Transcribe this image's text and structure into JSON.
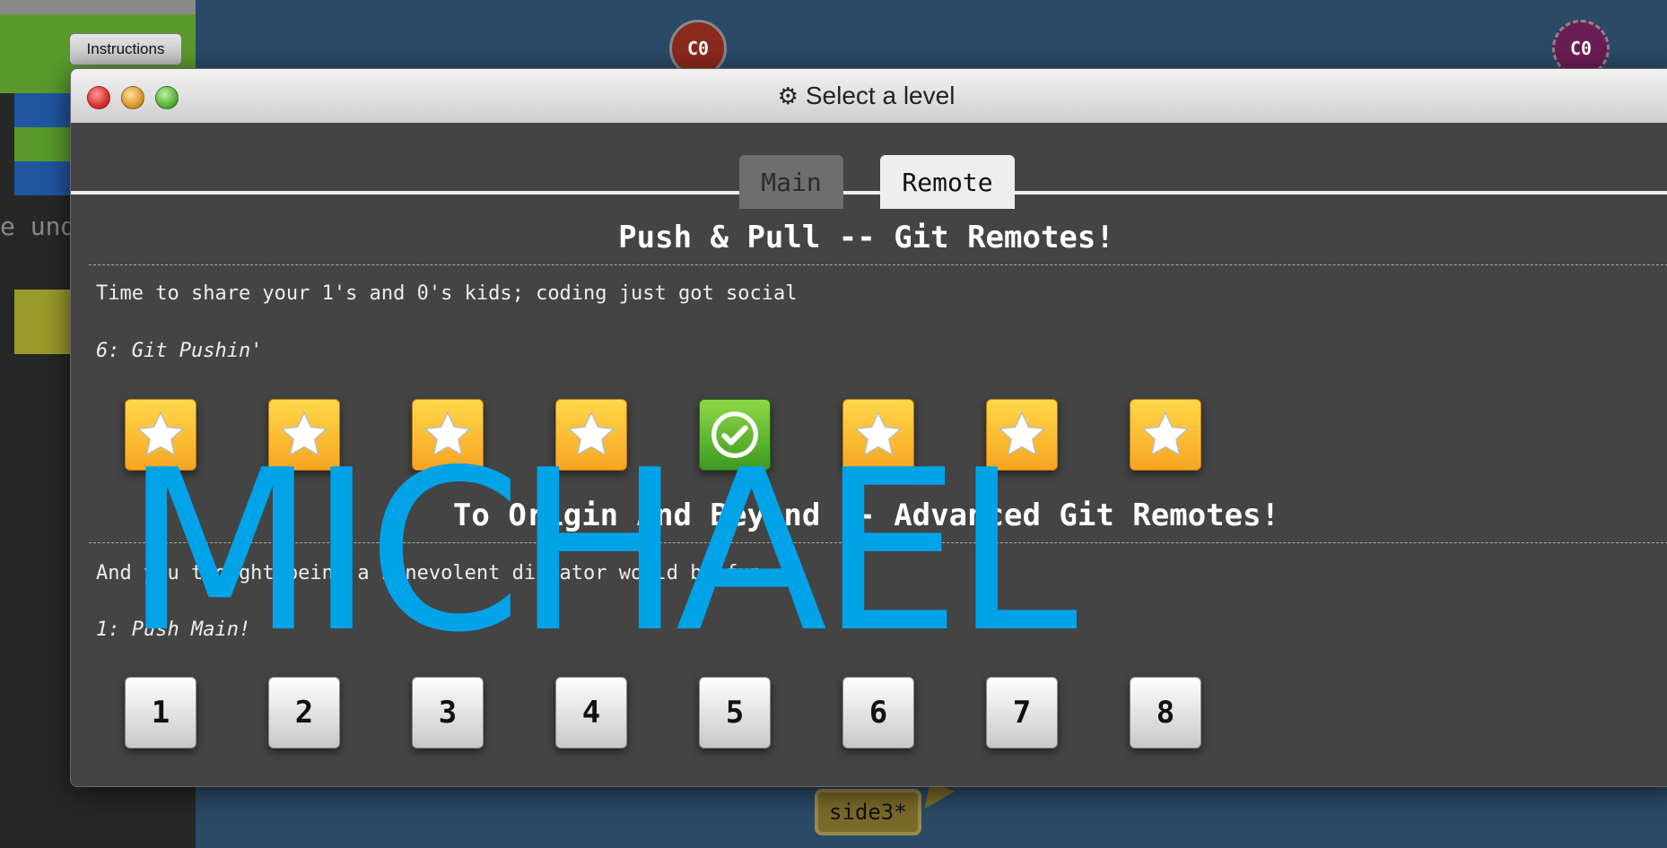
{
  "background": {
    "canvas_color": "#2a4a66"
  },
  "left_panel": {
    "instructions_label": "Instructions",
    "snippet_text": "e und"
  },
  "canvas": {
    "commits": [
      {
        "label": "C0",
        "color": "#8a2a1c"
      },
      {
        "label": "C0",
        "color": "#6a1d55"
      }
    ],
    "branch_tag": "side3*"
  },
  "modal": {
    "title": "Select a level",
    "tabs": [
      {
        "label": "Main",
        "selected": false
      },
      {
        "label": "Remote",
        "selected": true
      }
    ],
    "sequences": [
      {
        "title": "Push & Pull -- Git Remotes!",
        "about": "Time to share your 1's and 0's kids; coding just got social",
        "current": "6: Git Pushin'",
        "levels": [
          "star",
          "star",
          "star",
          "star",
          "completed",
          "star",
          "star",
          "star"
        ]
      },
      {
        "title": "To Origin And Beyond -- Advanced Git Remotes!",
        "about": "And you thought being a benevolent dictator would be fun...",
        "current": "1: Push Main!",
        "levels": [
          "1",
          "2",
          "3",
          "4",
          "5",
          "6",
          "7",
          "8"
        ]
      }
    ]
  },
  "watermark": {
    "text": "MICHAEL",
    "color": "#00a3e8"
  },
  "colors": {
    "star_gold": "#ffd84a",
    "completed_green": "#3d9a22"
  }
}
